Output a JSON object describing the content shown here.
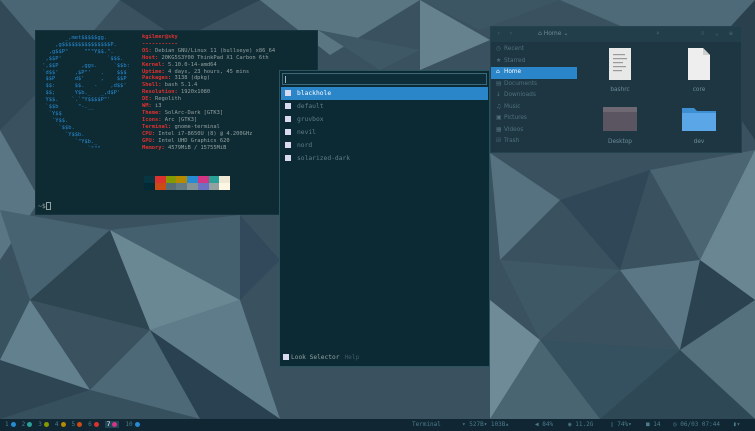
{
  "terminal": {
    "logo_lines": [
      "        _,met$$$$$gg.",
      "     ,g$$$$$$$$$$$$$$$P.",
      "   ,g$$P\"     \"\"\"Y$$.\".",
      "  ,$$P'              `$$$.",
      " ',$$P       ,ggs.     `$$b:",
      " `d$$'     ,$P\"'   .    $$$",
      "  $$P      d$'     ,    $$P",
      "  $$:      $$.   -    ,d$$'",
      "  $$;      Y$b._   _,d$P'",
      "  Y$$.    `.`\"Y$$$$P\"'",
      "  `$$b      \"-.__",
      "   `Y$$",
      "    `Y$$.",
      "      `$$b.",
      "        `Y$$b.",
      "           `\"Y$b._",
      "               `\"\"\""
    ],
    "user_host": "kgilmer@sky",
    "separator": "-----------",
    "info": [
      {
        "key": "OS",
        "value": "Debian GNU/Linux 11 (bullseye) x86_64"
      },
      {
        "key": "Host",
        "value": "20KG5S3Y00 ThinkPad X1 Carbon 6th"
      },
      {
        "key": "Kernel",
        "value": "5.10.0-14-amd64"
      },
      {
        "key": "Uptime",
        "value": "4 days, 23 hours, 45 mins"
      },
      {
        "key": "Packages",
        "value": "3138 (dpkg)"
      },
      {
        "key": "Shell",
        "value": "bash 5.1.4"
      },
      {
        "key": "Resolution",
        "value": "1920x1080"
      },
      {
        "key": "DE",
        "value": "Regolith"
      },
      {
        "key": "WM",
        "value": "i3"
      },
      {
        "key": "Theme",
        "value": "SolArc-Dark [GTK3]"
      },
      {
        "key": "Icons",
        "value": "Arc [GTK3]"
      },
      {
        "key": "Terminal",
        "value": "gnome-terminal"
      },
      {
        "key": "CPU",
        "value": "Intel i7-8650U (8) @ 4.200GHz"
      },
      {
        "key": "GPU",
        "value": "Intel UHD Graphics 620"
      },
      {
        "key": "Memory",
        "value": "4579MiB / 15755MiB"
      }
    ],
    "palette": [
      "#073642",
      "#dc322f",
      "#859900",
      "#b58900",
      "#268bd2",
      "#d33682",
      "#2aa198",
      "#eee8d5",
      "#002b36",
      "#cb4b16",
      "#586e75",
      "#657b83",
      "#839496",
      "#6c71c4",
      "#93a1a1",
      "#fdf6e3"
    ],
    "prompt": "~$"
  },
  "files": {
    "location": "Home",
    "sidebar": [
      {
        "icon": "clock-icon",
        "glyph": "◷",
        "label": "Recent"
      },
      {
        "icon": "star-icon",
        "glyph": "★",
        "label": "Starred"
      },
      {
        "icon": "home-icon",
        "glyph": "⌂",
        "label": "Home",
        "active": true
      },
      {
        "icon": "document-icon",
        "glyph": "▤",
        "label": "Documents"
      },
      {
        "icon": "download-icon",
        "glyph": "↓",
        "label": "Downloads"
      },
      {
        "icon": "music-icon",
        "glyph": "♫",
        "label": "Music"
      },
      {
        "icon": "picture-icon",
        "glyph": "▣",
        "label": "Pictures"
      },
      {
        "icon": "video-icon",
        "glyph": "▦",
        "label": "Videos"
      },
      {
        "icon": "trash-icon",
        "glyph": "☒",
        "label": "Trash"
      }
    ],
    "items": [
      {
        "name": "bashrc",
        "kind": "text"
      },
      {
        "name": "core",
        "kind": "file"
      },
      {
        "name": "Desktop",
        "kind": "desktop"
      },
      {
        "name": "dev",
        "kind": "folder"
      }
    ]
  },
  "selector": {
    "looks": [
      "blackhole",
      "default",
      "gruvbox",
      "nevil",
      "nord",
      "solarized-dark"
    ],
    "selected_index": 0,
    "footer_tab": "Look Selector",
    "footer_help": "Help"
  },
  "bar": {
    "workspaces": [
      {
        "label": "1",
        "color": "#268bd2"
      },
      {
        "label": "2",
        "color": "#2aa198"
      },
      {
        "label": "3",
        "color": "#859900"
      },
      {
        "label": "4",
        "color": "#b58900"
      },
      {
        "label": "5",
        "color": "#cb4b16"
      },
      {
        "label": "6",
        "color": "#dc322f"
      },
      {
        "label": "7",
        "color": "#d33682",
        "active": true
      },
      {
        "label": "10",
        "color": "#268bd2"
      }
    ],
    "focused_app": "Terminal",
    "network": "527B▾ 103B▴",
    "volume": "84%",
    "disk": "11.2G",
    "battery": "74%▾",
    "notifications": "14",
    "clock": "06/03 07:44"
  },
  "colors": {
    "accent": "#2a85c9",
    "bg": "#0c2a34"
  }
}
